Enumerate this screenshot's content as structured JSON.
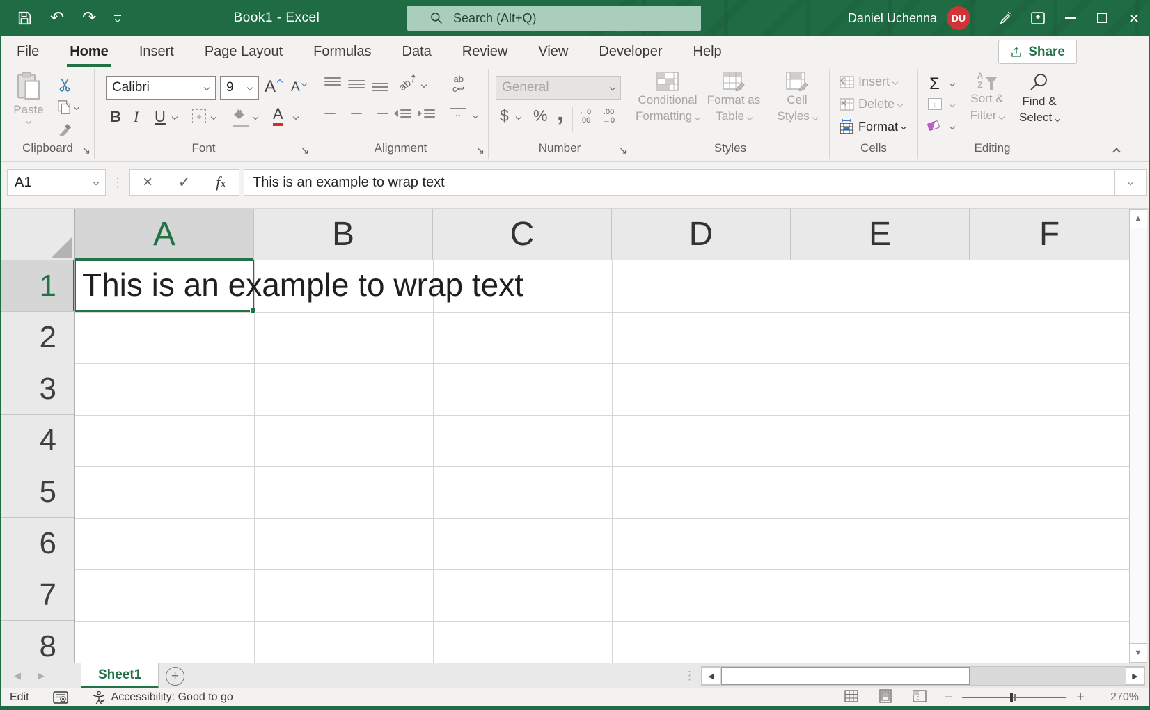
{
  "window": {
    "title": "Book1 - Excel",
    "search_placeholder": "Search (Alt+Q)",
    "user_name": "Daniel Uchenna",
    "user_initials": "DU"
  },
  "menu": {
    "tabs": [
      "File",
      "Home",
      "Insert",
      "Page Layout",
      "Formulas",
      "Data",
      "Review",
      "View",
      "Developer",
      "Help"
    ],
    "active_tab": "Home",
    "share_label": "Share"
  },
  "ribbon": {
    "clipboard": {
      "label": "Clipboard",
      "paste": "Paste"
    },
    "font": {
      "label": "Font",
      "family": "Calibri",
      "size": "9"
    },
    "alignment": {
      "label": "Alignment"
    },
    "number": {
      "label": "Number",
      "format": "General"
    },
    "styles": {
      "label": "Styles",
      "conditional_1": "Conditional",
      "conditional_2": "Formatting",
      "format_table_1": "Format as",
      "format_table_2": "Table",
      "cell_styles_1": "Cell",
      "cell_styles_2": "Styles"
    },
    "cells": {
      "label": "Cells",
      "insert": "Insert",
      "delete": "Delete",
      "format": "Format"
    },
    "editing": {
      "label": "Editing",
      "sort_1": "Sort &",
      "sort_2": "Filter",
      "find_1": "Find &",
      "find_2": "Select"
    }
  },
  "formula_bar": {
    "name_box": "A1",
    "content": "This is an example to wrap text"
  },
  "grid": {
    "columns": [
      "A",
      "B",
      "C",
      "D",
      "E",
      "F"
    ],
    "rows": [
      "1",
      "2",
      "3",
      "4",
      "5",
      "6",
      "7",
      "8"
    ],
    "active_cell": "A1",
    "active_cell_text": "This is an example to wrap text",
    "selected_column": "A",
    "selected_row": "1"
  },
  "sheet_bar": {
    "active_sheet": "Sheet1"
  },
  "status_bar": {
    "mode": "Edit",
    "accessibility": "Accessibility: Good to go",
    "zoom_level": "270%"
  },
  "icons": {
    "launcher": "↘",
    "undo": "↶",
    "redo": "↷",
    "cancel": "×",
    "enter": "✓",
    "fx_f": "f",
    "fx_x": "x",
    "dots": "⋮",
    "sigma": "Σ",
    "fill_down": "↓",
    "dollar": "$",
    "percent": "%",
    "comma": ",",
    "bold": "B",
    "italic": "I",
    "underline": "U",
    "grow_font": "A",
    "shrink_font": "A",
    "font_color": "A",
    "orientation": "ab↗",
    "wrap_top": "ab",
    "wrap_bottom": "c↩",
    "merge": "↔",
    "inc_decimal_top": "←0",
    "inc_decimal_bottom": ".00",
    "dec_decimal_top": ".00",
    "dec_decimal_bottom": "→0",
    "sort_a": "A",
    "sort_z": "Z",
    "prev": "◀",
    "next": "▶",
    "up": "▲",
    "down": "▼",
    "left": "◀",
    "right": "▶",
    "add_sheet": "+",
    "zoom_out": "−",
    "zoom_in": "+",
    "borders_plus": "+"
  },
  "colors": {
    "accent_green": "#217346",
    "titlebar_green": "#1f6b43",
    "avatar_red": "#d13438",
    "search_box_green": "#a9cfbc",
    "disabled_gray": "#a8a6a4",
    "font_color_red": "#d92b2b",
    "format_blue": "#2b7cd3"
  }
}
